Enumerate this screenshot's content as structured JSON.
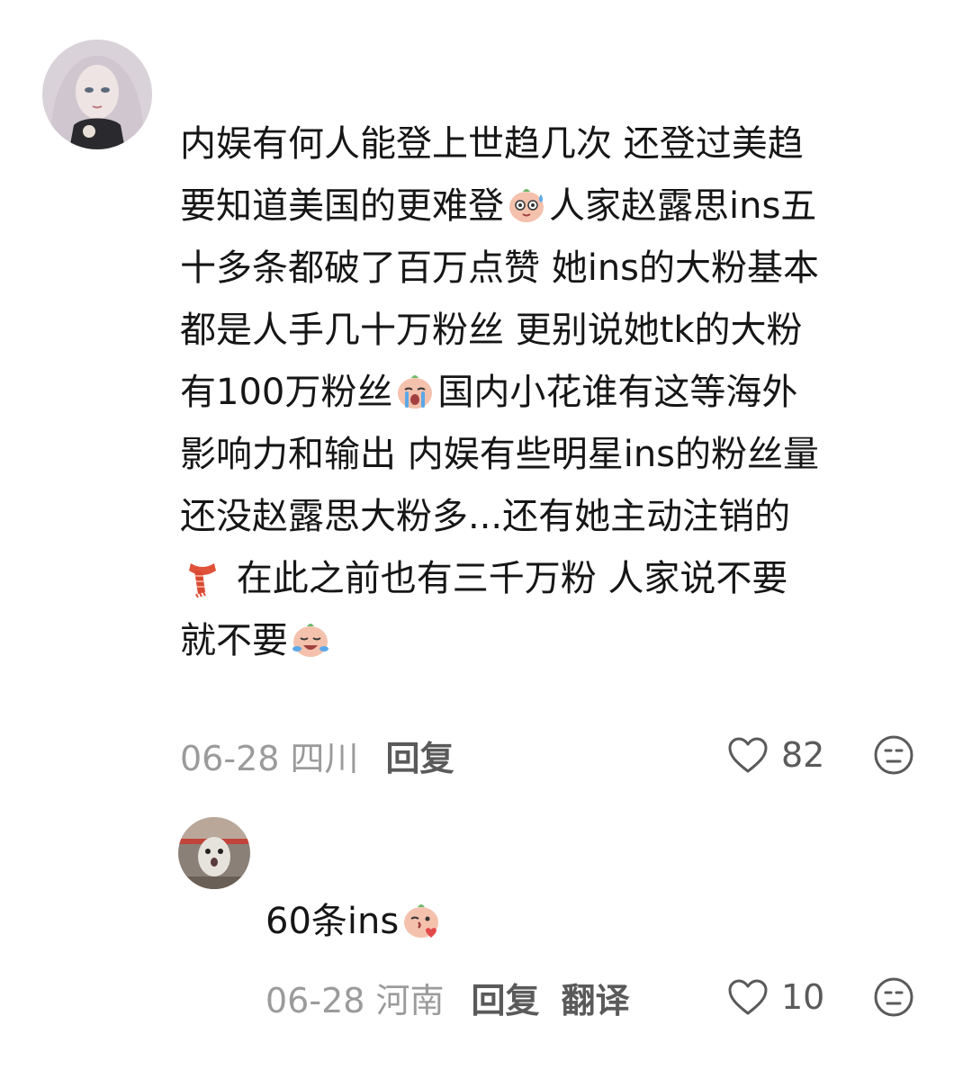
{
  "comment": {
    "lines": [
      "内娱有何人能登上世趋几次 还登过美趋",
      "要知道美国的更难登",
      "人家赵露思ins五",
      "十多条都破了百万点赞 她ins的大粉基本",
      "都是人手几十万粉丝 更别说她tk的大粉",
      "有100万粉丝",
      "国内小花谁有这等海外",
      "影响力和输出 内娱有些明星ins的粉丝量",
      "还没赵露思大粉多...还有她主动注销的",
      " 在此之前也有三千万粉 人家说不要",
      "就不要"
    ],
    "date": "06-28 四川",
    "reply_label": "回复",
    "likes": "82"
  },
  "reply": {
    "text": "60条ins",
    "date": "06-28 河南",
    "reply_label": "回复",
    "translate_label": "翻译",
    "likes": "10"
  },
  "icons": {
    "like": "heart-outline-icon",
    "dislike": "neutral-face-icon",
    "emoji_1": "sweat-face-emoji",
    "emoji_2": "crying-face-emoji",
    "emoji_3": "scarf-emoji",
    "emoji_4": "laugh-cry-emoji",
    "emoji_5": "kiss-face-emoji"
  },
  "colors": {
    "text": "#161616",
    "meta": "#9b9b9b",
    "action": "#5a5a5a"
  }
}
